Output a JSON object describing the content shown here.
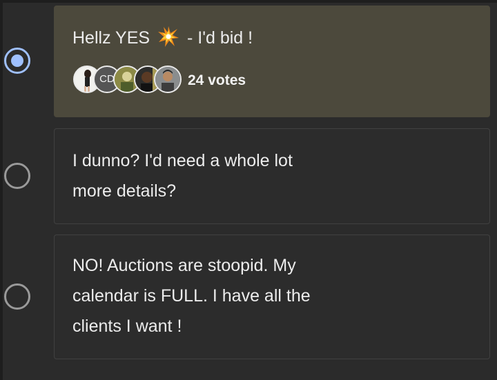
{
  "poll": {
    "options": [
      {
        "label_before": "Hellz YES",
        "emoji": "collision-icon",
        "label_after": "- I'd bid !",
        "selected": true,
        "votes": "24 votes",
        "voter_initials": "CD"
      },
      {
        "label": "I dunno? I'd need a whole lot\nmore details?",
        "selected": false
      },
      {
        "label": "NO! Auctions are stoopid. My\ncalendar is FULL. I have all the\nclients I want !",
        "selected": false
      }
    ]
  },
  "colors": {
    "selected_card": "#4c493c",
    "card": "#2c2c2c",
    "accent": "#9fc0ff",
    "background": "#2b2b2b"
  }
}
